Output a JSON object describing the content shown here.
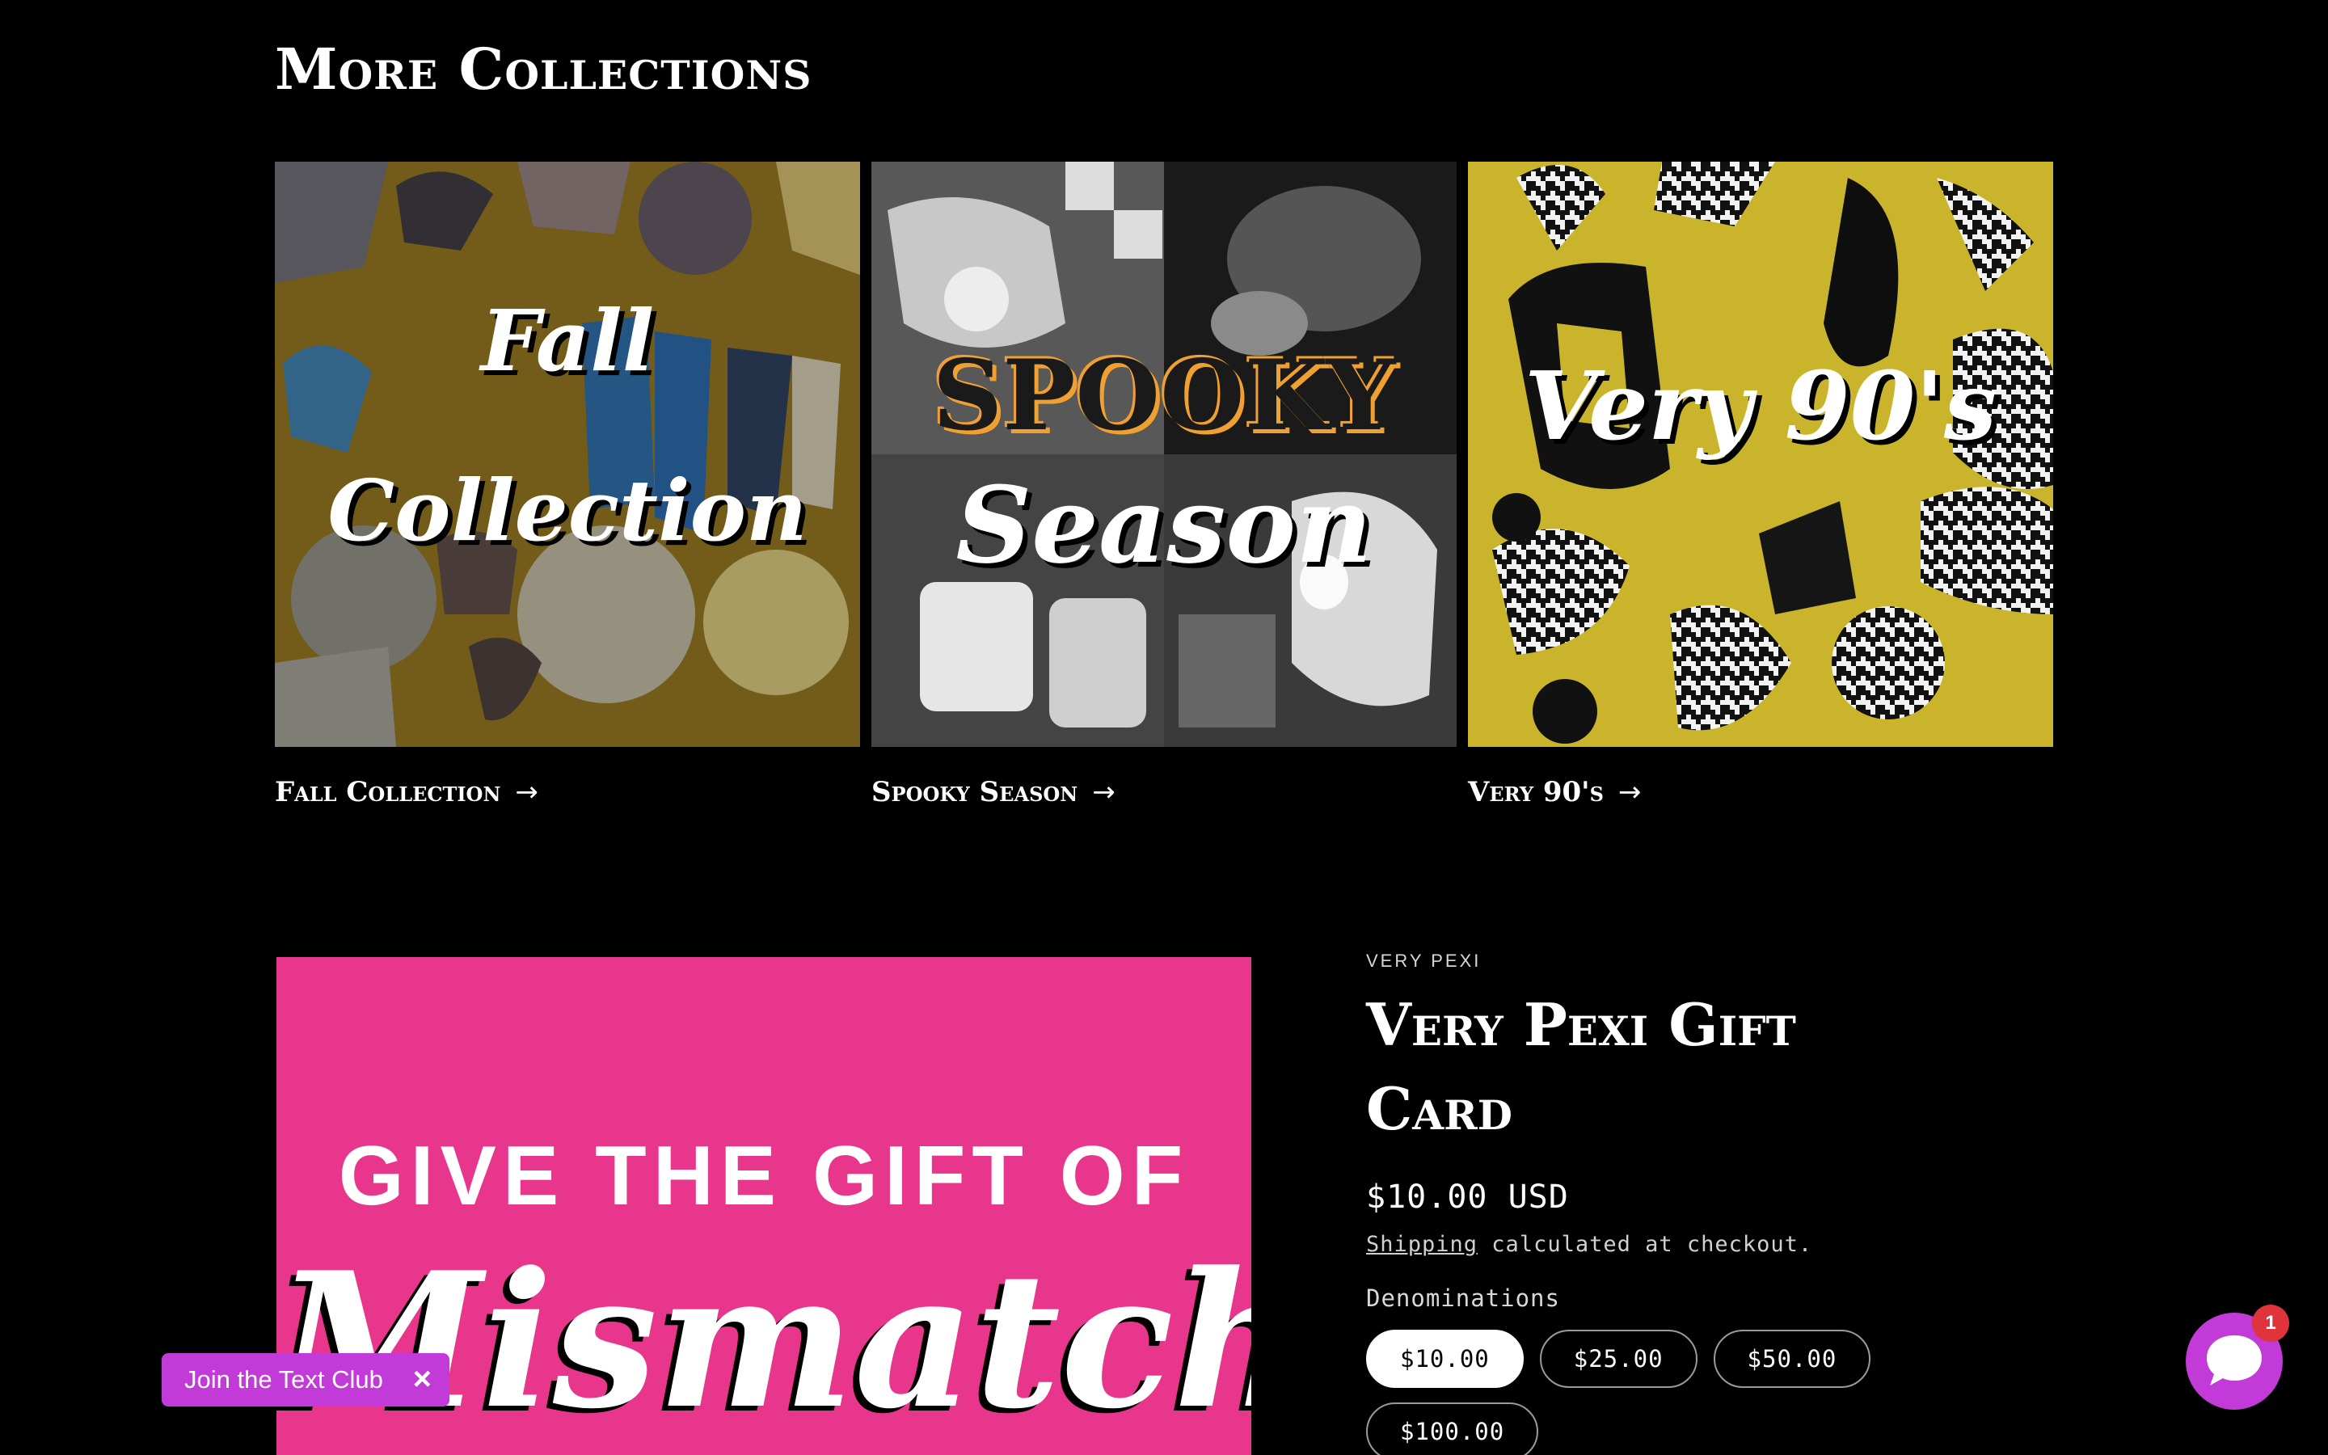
{
  "section": {
    "heading": "More Collections"
  },
  "collections": [
    {
      "overlay_line1": "Fall",
      "overlay_line2": "Collection",
      "label": "Fall Collection",
      "arrow": "→"
    },
    {
      "overlay_line1": "SPOOKY",
      "overlay_line2": "Season",
      "label": "Spooky Season",
      "arrow": "→"
    },
    {
      "overlay_line1": "Very 90's",
      "label": "Very 90's",
      "arrow": "→"
    }
  ],
  "product": {
    "image_line1": "GIVE THE GIFT OF",
    "image_line2": "Mismatch",
    "vendor": "VERY PEXI",
    "title": "Very Pexi Gift Card",
    "price": "$10.00 USD",
    "shipping_link": "Shipping",
    "shipping_rest": " calculated at checkout.",
    "denominations_label": "Denominations",
    "denominations": [
      "$10.00",
      "$25.00",
      "$50.00",
      "$100.00"
    ],
    "selected_denomination": "$10.00"
  },
  "text_club": {
    "label": "Join the Text Club",
    "close": "×"
  },
  "chat": {
    "badge_count": "1"
  },
  "colors": {
    "brand_pink": "#e8368d",
    "accent_purple": "#c23ad8",
    "badge_red": "#e0343c",
    "mustard": "#c9a227"
  },
  "icons": {
    "arrow": "arrow-right-icon",
    "chat": "chat-bubble-icon",
    "close": "close-icon"
  }
}
